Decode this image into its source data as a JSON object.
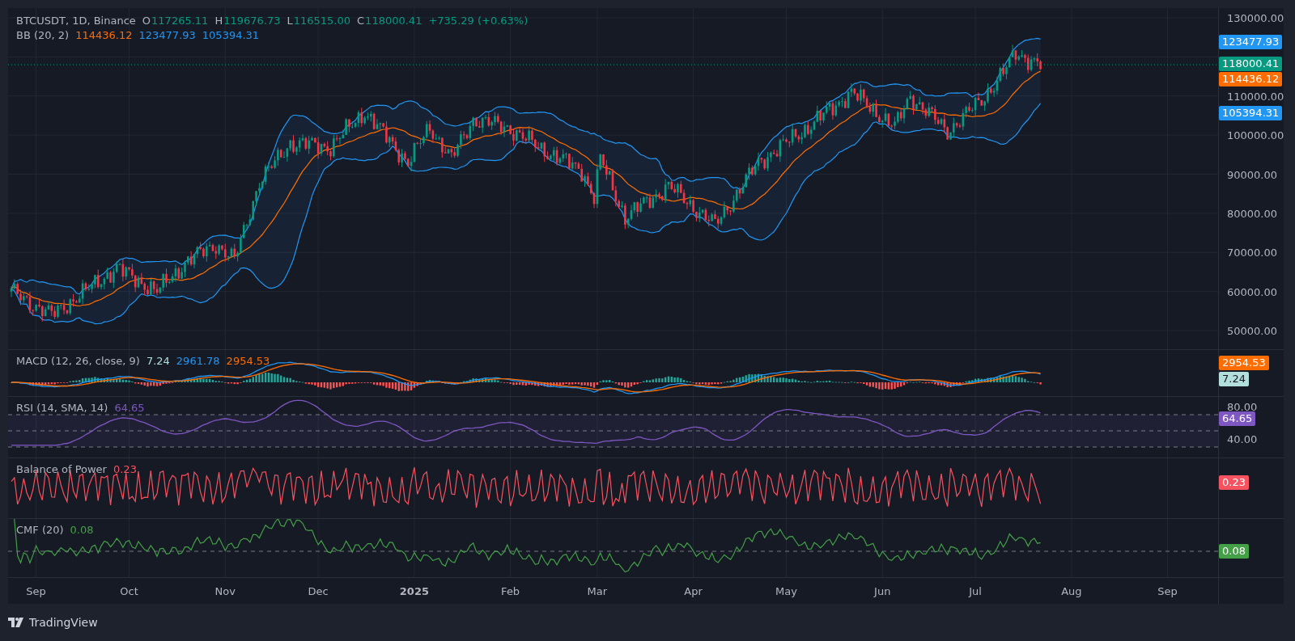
{
  "chart": {
    "symbol": "BTCUSDT, 1D, Binance",
    "ohlc": [
      {
        "label": "O",
        "value": "117265.11"
      },
      {
        "label": "H",
        "value": "119676.73"
      },
      {
        "label": "L",
        "value": "116515.00"
      },
      {
        "label": "C",
        "value": "118000.41"
      }
    ],
    "change": "+735.29 (+0.63%)",
    "indicator": {
      "name": "BB (20, 2)",
      "values": [
        {
          "text": "114436.12",
          "color": "#ff6d00"
        },
        {
          "text": "123477.93",
          "color": "#2196f3"
        },
        {
          "text": "105394.31",
          "color": "#2196f3"
        }
      ]
    },
    "price_axis": [
      "130000.00",
      "110000.00",
      "100000.00",
      "90000.00",
      "80000.00",
      "70000.00",
      "60000.00",
      "50000.00"
    ],
    "price_labels": [
      {
        "text": "123477.93",
        "color": "#2196f3"
      },
      {
        "text": "118000.41",
        "color": "#089981"
      },
      {
        "text": "114436.12",
        "color": "#ff6d00"
      },
      {
        "text": "105394.31",
        "color": "#2196f3"
      }
    ]
  },
  "panes": [
    {
      "kind": "macd",
      "name": "MACD (12, 26, close, 9)",
      "values": [
        {
          "text": "7.24",
          "color": "#b2dfdb"
        },
        {
          "text": "2961.78",
          "color": "#2196f3"
        },
        {
          "text": "2954.53",
          "color": "#ff6d00"
        }
      ],
      "labels": [
        {
          "text": "2954.53",
          "color": "#ff6d00"
        },
        {
          "text": "7.24",
          "color": "#b2dfdb"
        }
      ]
    },
    {
      "kind": "rsi",
      "name": "RSI (14, SMA, 14)",
      "values": [
        {
          "text": "64.65",
          "color": "#7e57c2"
        }
      ],
      "axis": [
        "80.00",
        "40.00"
      ],
      "labels": [
        {
          "text": "64.65",
          "color": "#7e57c2"
        }
      ]
    },
    {
      "kind": "bop",
      "name": "Balance of Power",
      "values": [
        {
          "text": "0.23",
          "color": "#f7525f"
        }
      ],
      "labels": [
        {
          "text": "0.23",
          "color": "#f7525f"
        }
      ]
    },
    {
      "kind": "cmf",
      "name": "CMF (20)",
      "values": [
        {
          "text": "0.08",
          "color": "#43a047"
        }
      ],
      "labels": [
        {
          "text": "0.08",
          "color": "#43a047"
        }
      ]
    }
  ],
  "time_axis": [
    {
      "label": "Sep",
      "kind": "month"
    },
    {
      "label": "Oct",
      "kind": "month"
    },
    {
      "label": "Nov",
      "kind": "month"
    },
    {
      "label": "Dec",
      "kind": "month"
    },
    {
      "label": "2025",
      "kind": "year"
    },
    {
      "label": "Feb",
      "kind": "month"
    },
    {
      "label": "Mar",
      "kind": "month"
    },
    {
      "label": "Apr",
      "kind": "month"
    },
    {
      "label": "May",
      "kind": "month"
    },
    {
      "label": "Jun",
      "kind": "month"
    },
    {
      "label": "Jul",
      "kind": "month"
    },
    {
      "label": "Aug",
      "kind": "month"
    },
    {
      "label": "Sep",
      "kind": "month"
    }
  ],
  "footer": {
    "brand": "TradingView"
  }
}
